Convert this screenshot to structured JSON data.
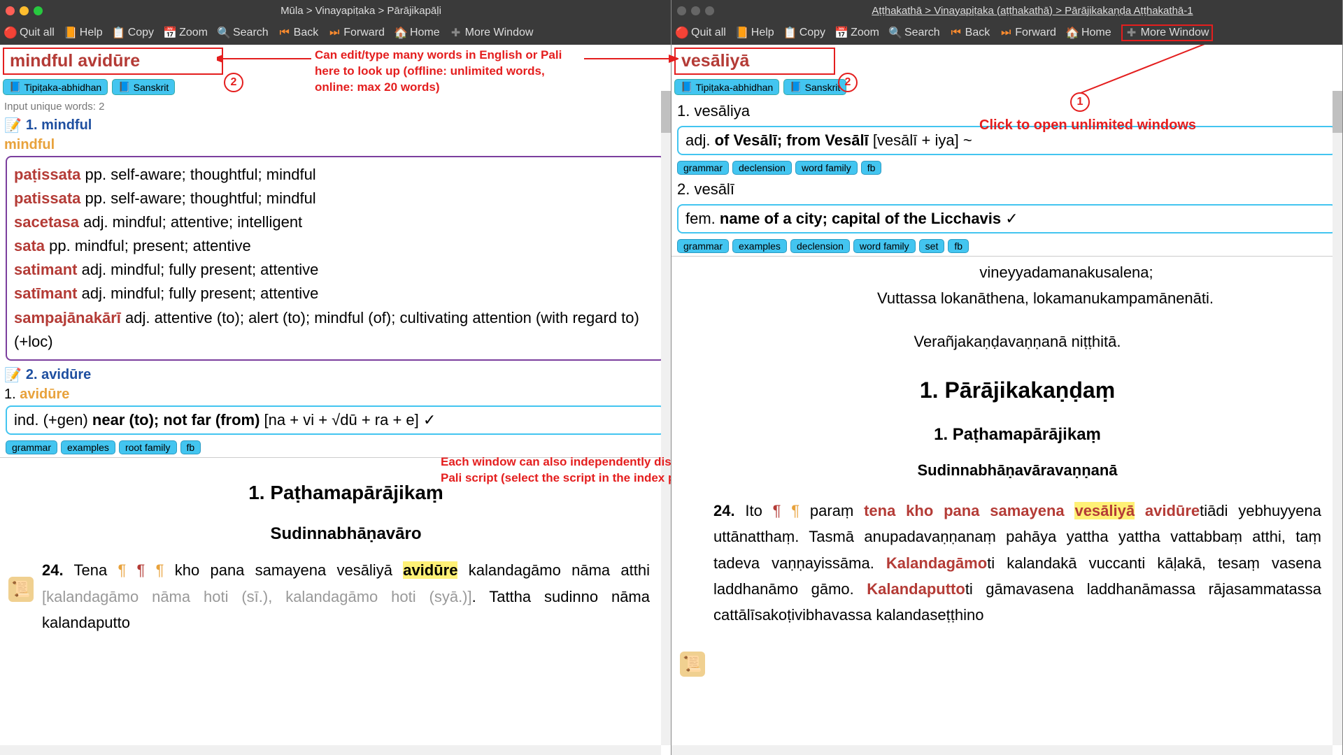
{
  "left": {
    "title": "Mūla > Vinayapiṭaka > Pārājikapāḷi",
    "toolbar": {
      "quit": "Quit all",
      "help": "Help",
      "copy": "Copy",
      "zoom": "Zoom",
      "search": "Search",
      "back": "Back",
      "forward": "Forward",
      "home": "Home",
      "more": "More Window"
    },
    "search_value": "mindful avidūre",
    "badge1": "Tipiṭaka-abhidhan",
    "badge2": "Sanskrit",
    "unique": "Input unique words: 2",
    "entry1_num": "1. mindful",
    "entry1_word": "mindful",
    "defs": [
      {
        "t": "paṭissata",
        "d": "pp. self-aware; thoughtful; mindful"
      },
      {
        "t": "patissata",
        "d": "pp. self-aware; thoughtful; mindful"
      },
      {
        "t": "sacetasa",
        "d": "adj. mindful; attentive; intelligent"
      },
      {
        "t": "sata",
        "d": "pp. mindful; present; attentive"
      },
      {
        "t": "satimant",
        "d": "adj. mindful; fully present; attentive"
      },
      {
        "t": "satīmant",
        "d": "adj. mindful; fully present; attentive"
      },
      {
        "t": "sampajānakārī",
        "d": "adj. attentive (to); alert (to); mindful (of); cultivating attention (with regard to) (+loc)"
      }
    ],
    "entry2_num": "2. avidūre",
    "entry2_sub": "1. ",
    "entry2_word": "avidūre",
    "def2_pre": "ind. (+gen) ",
    "def2_bold": "near (to); not far (from)",
    "def2_post": " [na + vi + √dū + ra + e] ✓",
    "tags2": [
      "grammar",
      "examples",
      "root family",
      "fb"
    ],
    "h2": "1. Paṭhamapārājikaṃ",
    "h3": "Sudinnabhāṇavāro",
    "para_num": "24.",
    "para_text1": "Tena ",
    "para_text2": " kho pana samayena vesāliyā ",
    "para_hl": "avidūre",
    "para_line2a": "kalandagāmo nāma atthi ",
    "para_variant": "[kalandagāmo nāma hoti (sī.), kalandagāmo hoti (syā.)]",
    "para_line2b": ". Tattha sudinno nāma kalandaputto"
  },
  "right": {
    "title": "Aṭṭhakathā > Vinayapiṭaka (aṭṭhakathā) > Pārājikakaṇḍa Aṭṭhakathā-1",
    "toolbar": {
      "quit": "Quit all",
      "help": "Help",
      "copy": "Copy",
      "zoom": "Zoom",
      "search": "Search",
      "back": "Back",
      "forward": "Forward",
      "home": "Home",
      "more": "More Window"
    },
    "search_value": "vesāliyā",
    "badge1": "Tipiṭaka-abhidhan",
    "badge2": "Sanskrit",
    "sub1": "1. vesāliya",
    "def1_pre": "adj. ",
    "def1_bold": "of Vesālī; from Vesālī",
    "def1_post": " [vesālī + iya] ~",
    "tags1": [
      "grammar",
      "declension",
      "word family",
      "fb"
    ],
    "sub2": "2. vesālī",
    "def2_pre": "fem. ",
    "def2_bold": "name of a city; capital of the Licchavis",
    "def2_post": " ✓",
    "tags2": [
      "grammar",
      "examples",
      "declension",
      "word family",
      "set",
      "fb"
    ],
    "line1": "vineyyadamanakusalena;",
    "line2": "Vuttassa lokanāthena, lokamanukampamānenāti.",
    "line3": "Verañjakaṇḍavaṇṇanā niṭṭhitā.",
    "h2": "1. Pārājikakaṇḍaṃ",
    "h3": "1. Paṭhamapārājikaṃ",
    "h4": "Sudinnabhāṇavāravaṇṇanā",
    "para_num": "24.",
    "p1": "Ito ",
    "p2": " paraṃ ",
    "p3": "tena kho pana samayena ",
    "p_hl": "vesāliyā",
    "p4": "avidūre",
    "p5": "tiādi yebhuyyena uttānatthaṃ. Tasmā anupadavaṇṇanaṃ pahāya yattha yattha vattabbaṃ atthi, taṃ tadeva vaṇṇayissāma. ",
    "p6": "Kalandagāmo",
    "p7": "ti kalandakā vuccanti kāḷakā, tesaṃ vasena laddhanāmo gāmo. ",
    "p8": "Kalandaputto",
    "p9": "ti gāmavasena laddhanāmassa rājasammatassa cattālīsakoṭivibhavassa kalandaseṭṭhino"
  },
  "annotations": {
    "a1": "Can edit/type many words in English or Pali here to look up (offline: unlimited words, online: max 20 words)",
    "a2": "Click to open unlimited windows",
    "a3": "Each window can also independently display a different Pali script (select  the script in the index page)."
  }
}
